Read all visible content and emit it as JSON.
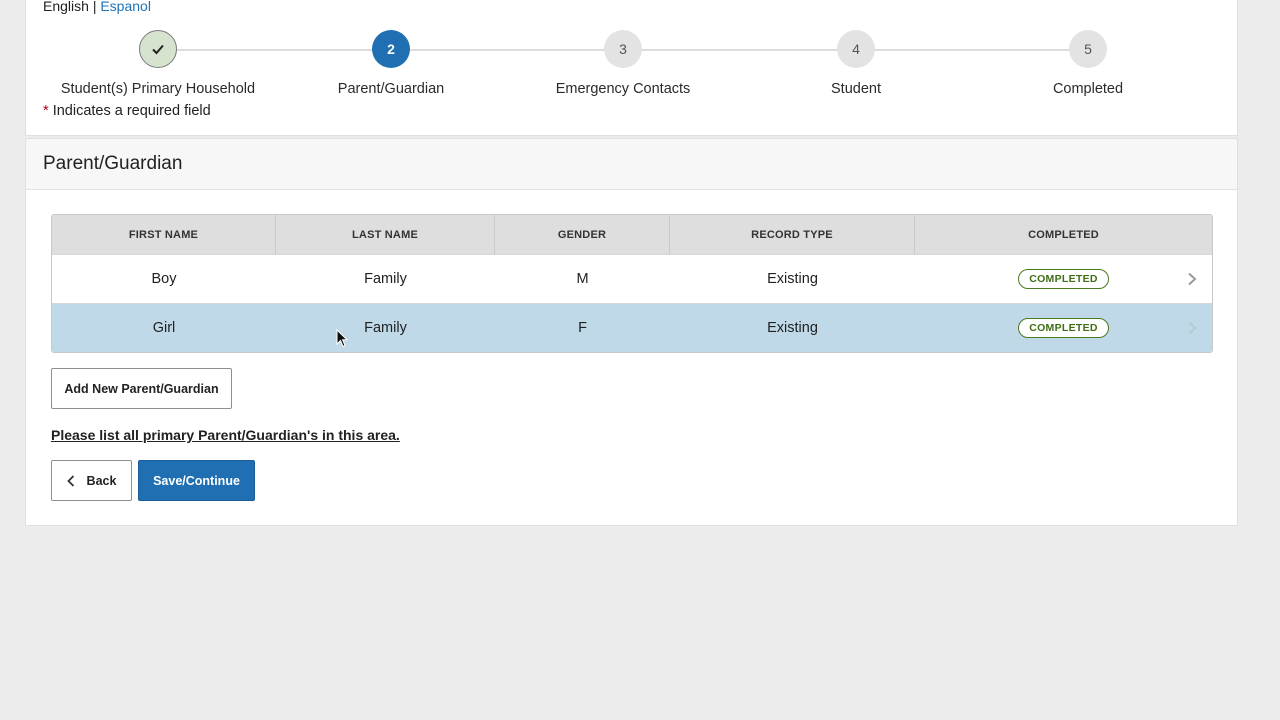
{
  "language": {
    "english": "English",
    "separator": "|",
    "spanish": "Espanol"
  },
  "steps": [
    {
      "number": "",
      "label": "Student(s) Primary Household",
      "state": "done"
    },
    {
      "number": "2",
      "label": "Parent/Guardian",
      "state": "active"
    },
    {
      "number": "3",
      "label": "Emergency Contacts",
      "state": "pending"
    },
    {
      "number": "4",
      "label": "Student",
      "state": "pending"
    },
    {
      "number": "5",
      "label": "Completed",
      "state": "pending"
    }
  ],
  "required_note": {
    "star": "*",
    "text": "Indicates a required field"
  },
  "section_title": "Parent/Guardian",
  "table": {
    "columns": [
      "FIRST NAME",
      "LAST NAME",
      "GENDER",
      "RECORD TYPE",
      "COMPLETED"
    ],
    "rows": [
      {
        "first_name": "Boy",
        "last_name": "Family",
        "gender": "M",
        "record_type": "Existing",
        "completed": "COMPLETED"
      },
      {
        "first_name": "Girl",
        "last_name": "Family",
        "gender": "F",
        "record_type": "Existing",
        "completed": "COMPLETED"
      }
    ]
  },
  "add_button": "Add New Parent/Guardian",
  "instruction": "Please list all primary Parent/Guardian's in this area.",
  "back_button": "Back",
  "save_button": "Save/Continue",
  "colors": {
    "primary": "#1f6fb2",
    "selected_row": "#bfd9e8",
    "completed_badge": "#4a7a1e"
  }
}
